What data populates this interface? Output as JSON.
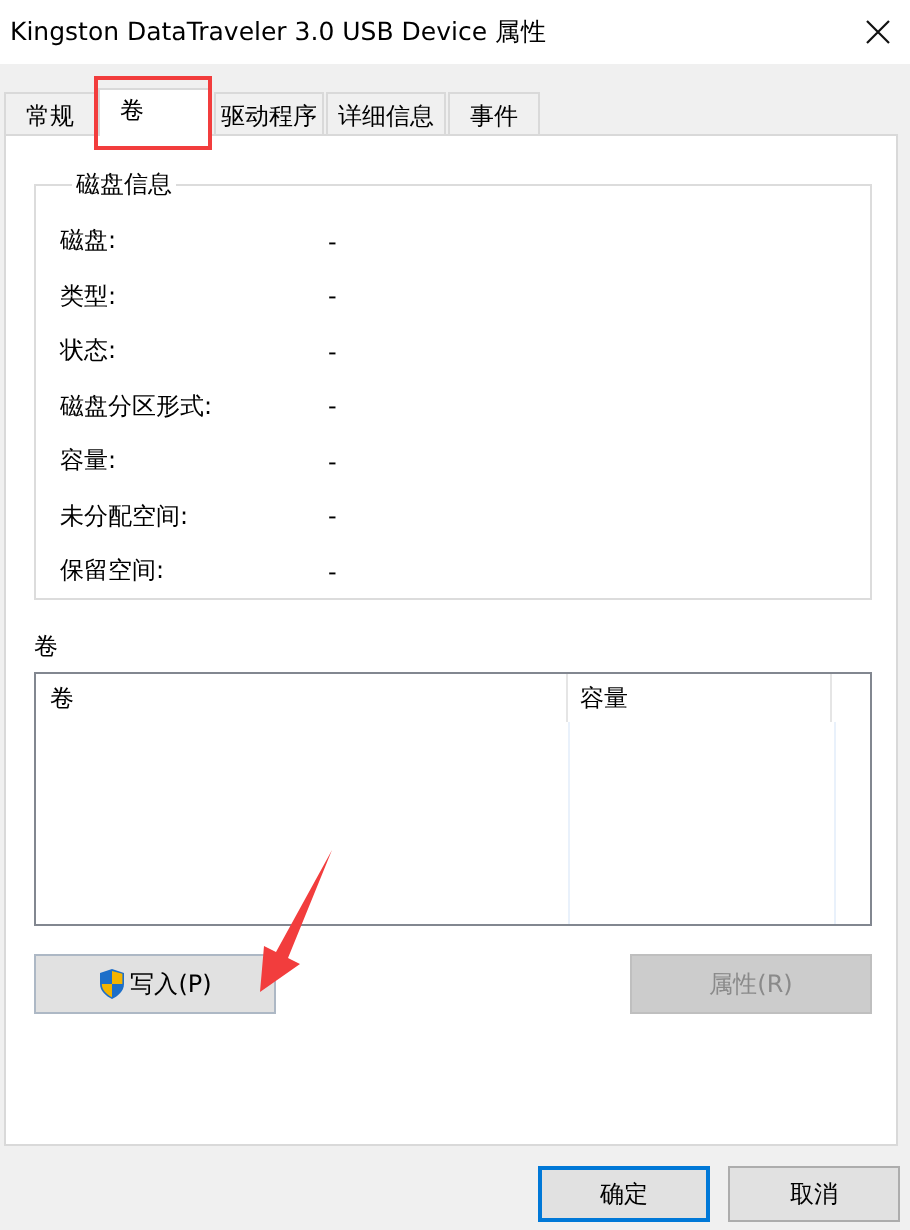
{
  "window": {
    "title": "Kingston DataTraveler 3.0 USB Device 属性"
  },
  "tabs": [
    {
      "label": "常规",
      "selected": false
    },
    {
      "label": "卷",
      "selected": true
    },
    {
      "label": "驱动程序",
      "selected": false
    },
    {
      "label": "详细信息",
      "selected": false
    },
    {
      "label": "事件",
      "selected": false
    }
  ],
  "disk_info": {
    "title": "磁盘信息",
    "rows": [
      {
        "label": "磁盘:",
        "value": "-"
      },
      {
        "label": "类型:",
        "value": "-"
      },
      {
        "label": "状态:",
        "value": "-"
      },
      {
        "label": "磁盘分区形式:",
        "value": "-"
      },
      {
        "label": "容量:",
        "value": "-"
      },
      {
        "label": "未分配空间:",
        "value": "-"
      },
      {
        "label": "保留空间:",
        "value": "-"
      }
    ]
  },
  "volumes": {
    "title": "卷",
    "columns": [
      "卷",
      "容量"
    ]
  },
  "actions": [
    {
      "label": "写入(P)",
      "disabled": false,
      "shield": true
    },
    {
      "label": "属性(R)",
      "disabled": true,
      "shield": false
    }
  ],
  "buttons": [
    {
      "label": "确定",
      "default": true
    },
    {
      "label": "取消",
      "default": false
    }
  ]
}
